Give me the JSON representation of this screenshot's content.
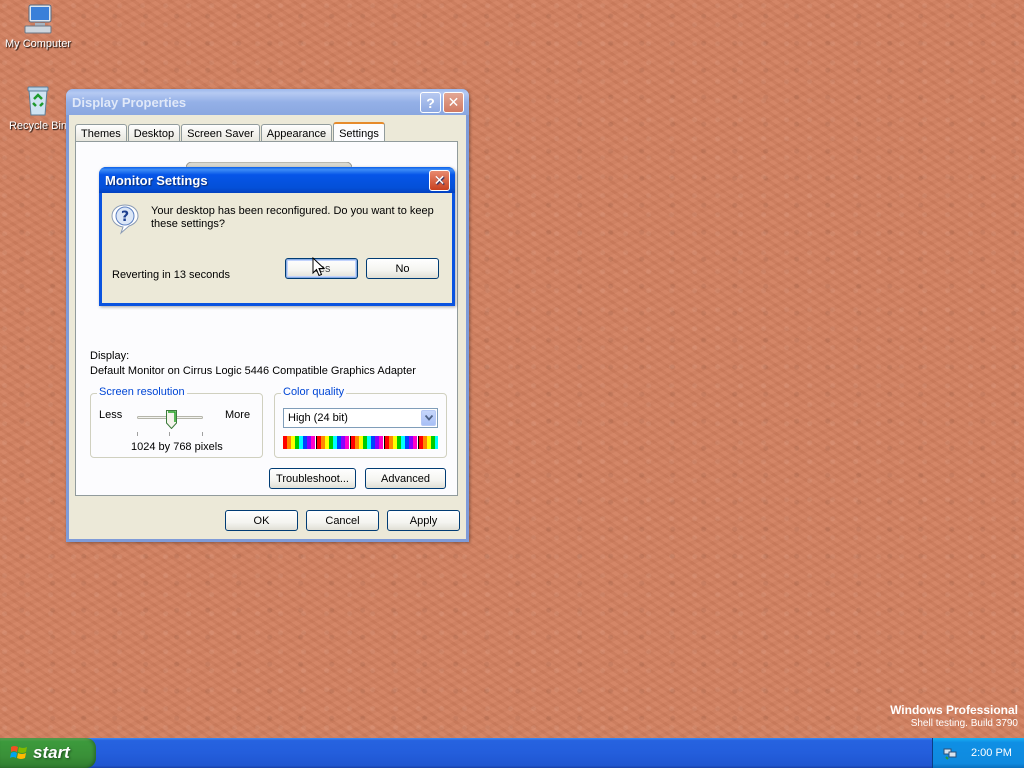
{
  "desktop": {
    "icons": [
      {
        "label": "My Computer",
        "icon": "my-computer-icon"
      },
      {
        "label": "Recycle Bin",
        "icon": "recycle-bin-icon"
      }
    ],
    "watermark": {
      "title": "Windows Professional",
      "subtitle": "Shell testing. Build 3790"
    },
    "background_color": "#d2805f"
  },
  "taskbar": {
    "start_label": "start",
    "clock": "2:00 PM",
    "tray_icon": "network-icon"
  },
  "display_properties": {
    "title": "Display Properties",
    "tabs": [
      {
        "label": "Themes",
        "active": false
      },
      {
        "label": "Desktop",
        "active": false
      },
      {
        "label": "Screen Saver",
        "active": false
      },
      {
        "label": "Appearance",
        "active": false
      },
      {
        "label": "Settings",
        "active": true
      }
    ],
    "display_label": "Display:",
    "display_value": "Default Monitor on Cirrus Logic 5446 Compatible Graphics Adapter",
    "resolution": {
      "group_title": "Screen resolution",
      "less_label": "Less",
      "more_label": "More",
      "value": "1024 by 768 pixels"
    },
    "color_quality": {
      "group_title": "Color quality",
      "selected": "High (24 bit)"
    },
    "buttons": {
      "troubleshoot": "Troubleshoot...",
      "advanced": "Advanced",
      "ok": "OK",
      "cancel": "Cancel",
      "apply": "Apply"
    }
  },
  "monitor_settings": {
    "title": "Monitor Settings",
    "message": "Your desktop has been reconfigured.  Do you want to keep these settings?",
    "countdown": "Reverting in 13 seconds",
    "yes_label": "Yes",
    "no_label": "No"
  },
  "colors": {
    "titlebar_active": "#0a53e0",
    "tab_highlight": "#e68b2c",
    "group_title": "#0046d5"
  }
}
